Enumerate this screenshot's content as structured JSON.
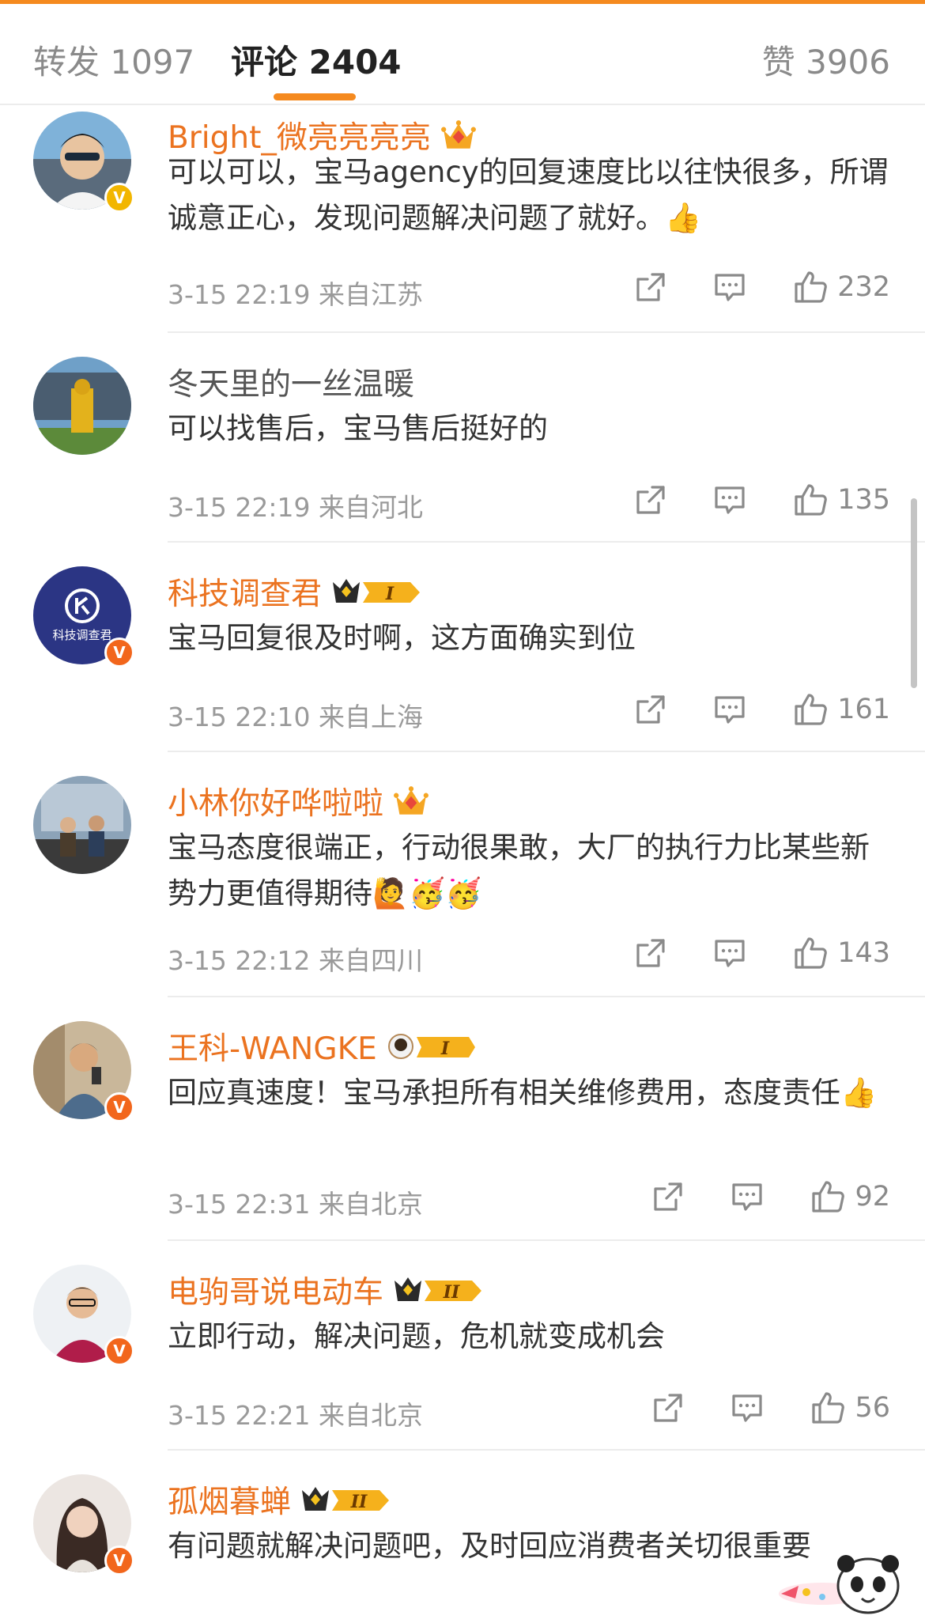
{
  "tabs": {
    "repost": "转发 1097",
    "comments": "评论 2404",
    "likes": "赞 3906"
  },
  "colors": {
    "accent": "#f58a1f",
    "name": "#eb7320",
    "meta": "#9a9a9a"
  },
  "comments": [
    {
      "name": "Bright_微亮亮亮亮",
      "badge": "crown-gem-icon",
      "text": "可以可以，宝马agency的回复速度比以往快很多，所谓诚意正心，发现问题解决问题了就好。👍",
      "time": "3-15 22:19 来自江苏",
      "likes": "232",
      "verified": "gold"
    },
    {
      "name": "冬天里的一丝温暖",
      "badge": "",
      "text": "可以找售后，宝马售后挺好的",
      "time": "3-15 22:19 来自河北",
      "likes": "135",
      "verified": ""
    },
    {
      "name": "科技调查君",
      "badge": "crown-level-I",
      "text": "宝马回复很及时啊，这方面确实到位",
      "time": "3-15 22:10 来自上海",
      "likes": "161",
      "verified": "orange",
      "avatar_text": "科技调查君"
    },
    {
      "name": "小林你好哗啦啦",
      "badge": "crown-gem-icon",
      "text": "宝马态度很端正，行动很果敢，大厂的执行力比某些新势力更值得期待🙋🥳🥳",
      "time": "3-15 22:12 来自四川",
      "likes": "143",
      "verified": ""
    },
    {
      "name": "王科-WANGKE",
      "badge": "astronaut-level-I",
      "text": "回应真速度！宝马承担所有相关维修费用，态度责任👍",
      "time": "3-15 22:31 来自北京",
      "likes": "92",
      "verified": "orange"
    },
    {
      "name": "电驹哥说电动车",
      "badge": "crown-level-II",
      "text": "立即行动，解决问题，危机就变成机会",
      "time": "3-15 22:21 来自北京",
      "likes": "56",
      "verified": "orange"
    },
    {
      "name": "孤烟暮蝉",
      "badge": "crown-level-II",
      "text": "有问题就解决问题吧，及时回应消费者关切很重要",
      "time": "",
      "likes": "",
      "verified": "orange"
    }
  ]
}
